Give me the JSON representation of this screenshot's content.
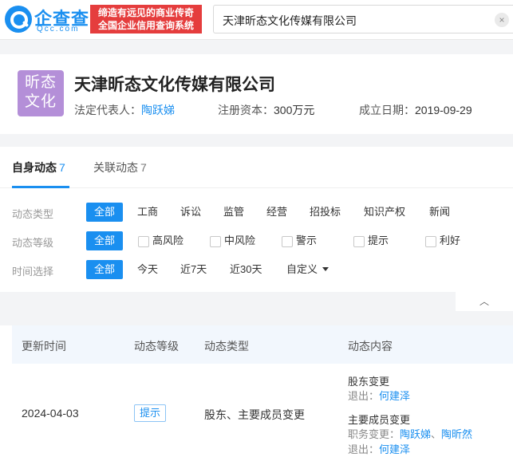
{
  "header": {
    "logo_text": "企查查",
    "logo_sub": "Qcc.com",
    "slogan_line1": "缔造有远见的商业传奇",
    "slogan_line2": "全国企业信用查询系统",
    "search_value": "天津昕态文化传媒有限公司",
    "clear_icon": "×"
  },
  "company": {
    "avatar_line1": "昕态",
    "avatar_line2": "文化",
    "name": "天津昕态文化传媒有限公司",
    "legal_rep_label": "法定代表人：",
    "legal_rep": "陶跃娣",
    "capital_label": "注册资本：",
    "capital": "300万元",
    "founded_label": "成立日期：",
    "founded": "2019-09-29"
  },
  "tabs": [
    {
      "label": "自身动态",
      "count": "7"
    },
    {
      "label": "关联动态",
      "count": "7"
    }
  ],
  "filters": {
    "type_label": "动态类型",
    "type_options": [
      "全部",
      "工商",
      "诉讼",
      "监管",
      "经营",
      "招投标",
      "知识产权",
      "新闻"
    ],
    "level_label": "动态等级",
    "level_all": "全部",
    "level_options": [
      "高风险",
      "中风险",
      "警示",
      "提示",
      "利好"
    ],
    "time_label": "时间选择",
    "time_options": [
      "全部",
      "今天",
      "近7天",
      "近30天",
      "自定义"
    ],
    "collapse_icon": "︿"
  },
  "table": {
    "headers": [
      "更新时间",
      "动态等级",
      "动态类型",
      "动态内容"
    ],
    "row": {
      "date": "2024-04-03",
      "level": "提示",
      "type": "股东、主要成员变更",
      "content": {
        "section1_title": "股东变更",
        "section1_exit_label": "退出：",
        "section1_exit": "何建泽",
        "section2_title": "主要成员变更",
        "section2_change_label": "职务变更：",
        "section2_change_a": "陶跃娣",
        "section2_change_sep": "、",
        "section2_change_b": "陶昕然",
        "section2_exit_label": "退出：",
        "section2_exit": "何建泽"
      }
    }
  },
  "colors": {
    "accent": "#1a8ff0",
    "slogan_bg": "#e53d3d",
    "avatar_bg": "#b48fd8"
  }
}
